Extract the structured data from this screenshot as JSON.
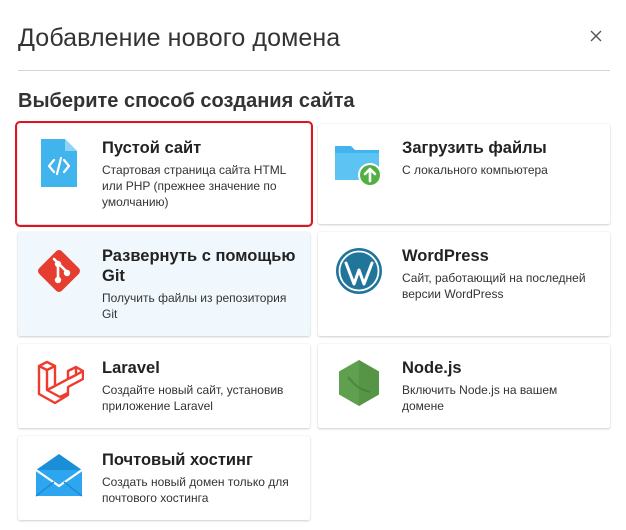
{
  "dialog": {
    "title": "Добавление нового домена",
    "subtitle": "Выберите способ создания сайта"
  },
  "options": [
    {
      "name": "Пустой сайт",
      "desc": "Стартовая страница сайта HTML или PHP (прежнее значение по умолчанию)",
      "icon": "code-file-icon",
      "selected": true
    },
    {
      "name": "Загрузить файлы",
      "desc": "С локального компьютера",
      "icon": "folder-upload-icon"
    },
    {
      "name": "Развернуть с помощью Git",
      "desc": "Получить файлы из репозитория Git",
      "icon": "git-icon",
      "hover": true
    },
    {
      "name": "WordPress",
      "desc": "Сайт, работающий на последней версии WordPress",
      "icon": "wordpress-icon"
    },
    {
      "name": "Laravel",
      "desc": "Создайте новый сайт, установив приложение Laravel",
      "icon": "laravel-icon"
    },
    {
      "name": "Node.js",
      "desc": "Включить Node.js на вашем домене",
      "icon": "nodejs-icon"
    },
    {
      "name": "Почтовый хостинг",
      "desc": "Создать новый домен только для почтового хостинга",
      "icon": "mail-icon"
    }
  ],
  "colors": {
    "selected_outline": "#e0141e",
    "hover_background": "#f1f8fd",
    "file_blue": "#41b4ee",
    "git_red": "#e53d2f",
    "wordpress_blue": "#21759b",
    "laravel_red": "#ef3b2d",
    "node_green": "#5fa04e",
    "upload_green": "#52b043"
  }
}
